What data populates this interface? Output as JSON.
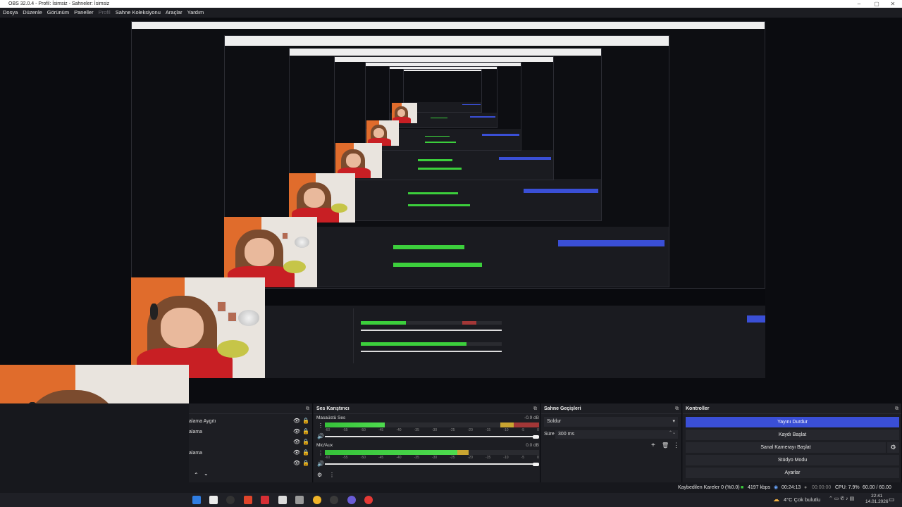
{
  "window": {
    "title": "OBS 32.0.4 - Profil: İsimsiz - Sahneler: İsimsiz"
  },
  "menu": {
    "items": [
      "Dosya",
      "Düzenle",
      "Görünüm",
      "Paneller",
      "Profil",
      "Sahne Koleksiyonu",
      "Araçlar",
      "Yardım"
    ],
    "disabled_index": 4
  },
  "sources": {
    "items": [
      "alama Aygıtı",
      "alama",
      "alama"
    ]
  },
  "mixer": {
    "title": "Ses Karıştırıcı",
    "channels": [
      {
        "name": "Masaüstü Ses",
        "db": "-0.9 dB",
        "volume": 1.0
      },
      {
        "name": "Mic/Aux",
        "db": "0.0 dB",
        "volume": 1.0
      }
    ],
    "ticks": [
      "-60",
      "-55",
      "-50",
      "-45",
      "-40",
      "-35",
      "-30",
      "-25",
      "-20",
      "-15",
      "-10",
      "-5",
      "0"
    ]
  },
  "transitions": {
    "title": "Sahne Geçişleri",
    "selected": "Soldur",
    "duration_label": "Süre",
    "duration_value": "300 ms"
  },
  "controls": {
    "title": "Kontroller",
    "stop_stream": "Yayını Durdur",
    "start_record": "Kaydı Başlat",
    "virtual_cam": "Sanal Kamerayı Başlat",
    "studio_mode": "Stüdyo Modu",
    "settings": "Ayarlar"
  },
  "status": {
    "dropped_frames": "Kaybedilen Kareler 0 (%0.0)",
    "bitrate": "4197 kbps",
    "stream_time": "00:24:13",
    "rec_time": "00:00:00",
    "cpu": "CPU: 7.9%",
    "fps": "60.00 / 60.00 FPS"
  },
  "taskbar": {
    "weather": "4°C  Çok bulutlu",
    "time": "22:41",
    "date": "14.01.2026"
  },
  "colors": {
    "accent": "#3a4fd6",
    "meter_green": "#3ccf3c",
    "meter_yellow": "#c9a531",
    "meter_red": "#a33737"
  },
  "icons": [
    "eye-icon",
    "lock-icon",
    "gear-icon",
    "plus-icon",
    "trash-icon",
    "menu-dots-icon",
    "speaker-icon",
    "chevron-up-icon",
    "chevron-down-icon",
    "windows-start-icon"
  ]
}
